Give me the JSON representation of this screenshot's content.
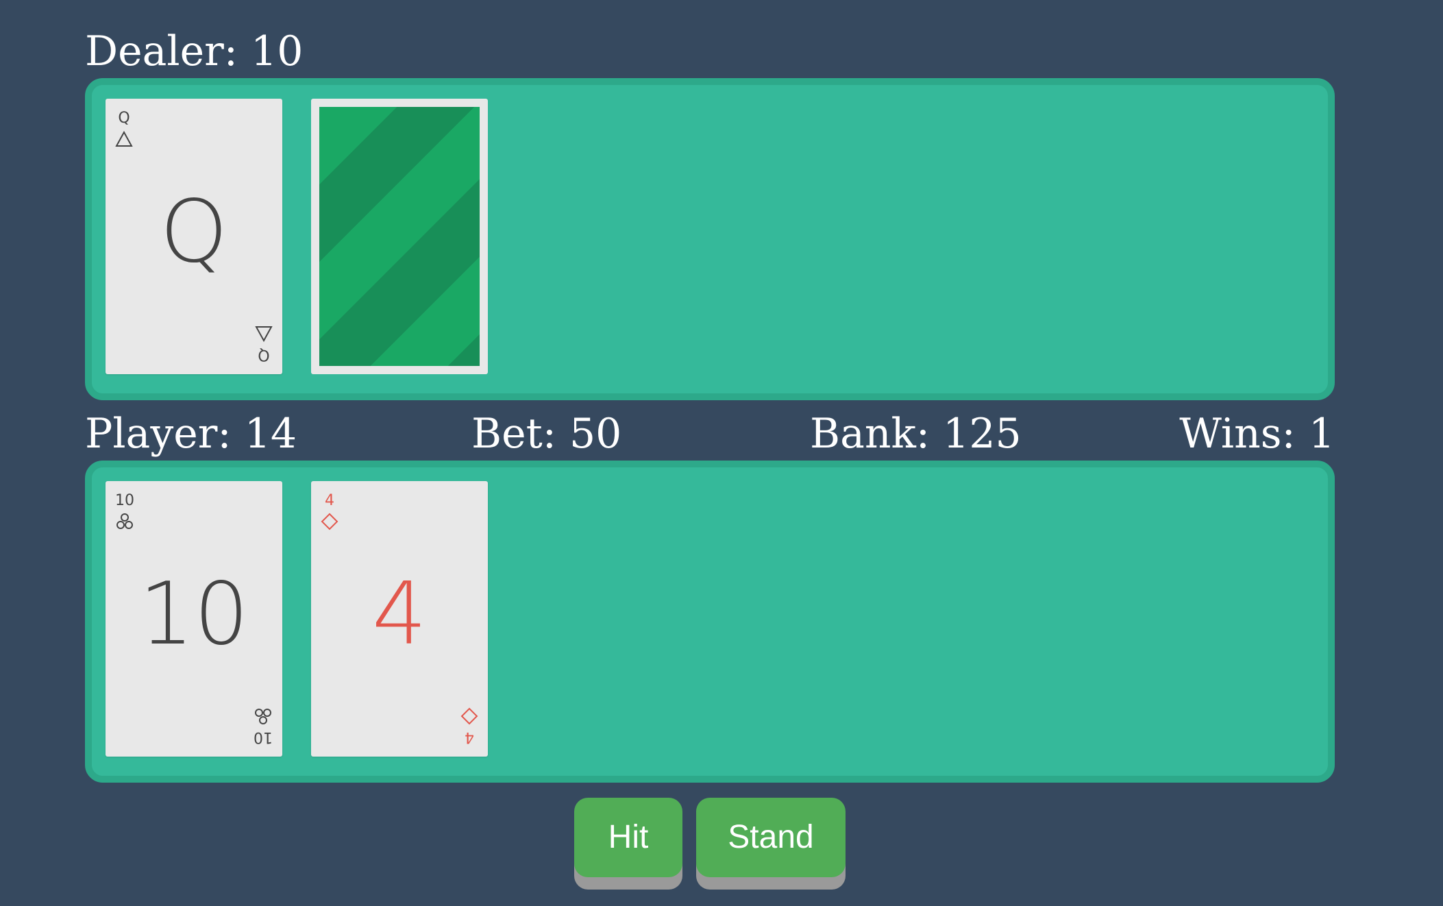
{
  "dealer": {
    "label": "Dealer: 10",
    "cards": [
      {
        "rank": "Q",
        "suit": "spades",
        "suit_icon": "triangle-spade-icon",
        "color": "#444444",
        "face_up": true
      },
      {
        "face_up": false,
        "back_colors": [
          "#1aa864",
          "#188f58"
        ]
      }
    ]
  },
  "player": {
    "label": "Player: 14",
    "cards": [
      {
        "rank": "10",
        "suit": "clubs",
        "suit_icon": "club-icon",
        "color": "#444444",
        "face_up": true
      },
      {
        "rank": "4",
        "suit": "diamonds",
        "suit_icon": "diamond-icon",
        "color": "#e2574c",
        "face_up": true
      }
    ]
  },
  "stats": {
    "bet": "Bet: 50",
    "bank": "Bank: 125",
    "wins": "Wins: 1"
  },
  "controls": {
    "hit_label": "Hit",
    "stand_label": "Stand"
  },
  "colors": {
    "background": "#36495f",
    "table": "#35b99a",
    "table_border": "#2da98a",
    "button": "#51ad56",
    "button_shadow": "#9a9a9a"
  }
}
